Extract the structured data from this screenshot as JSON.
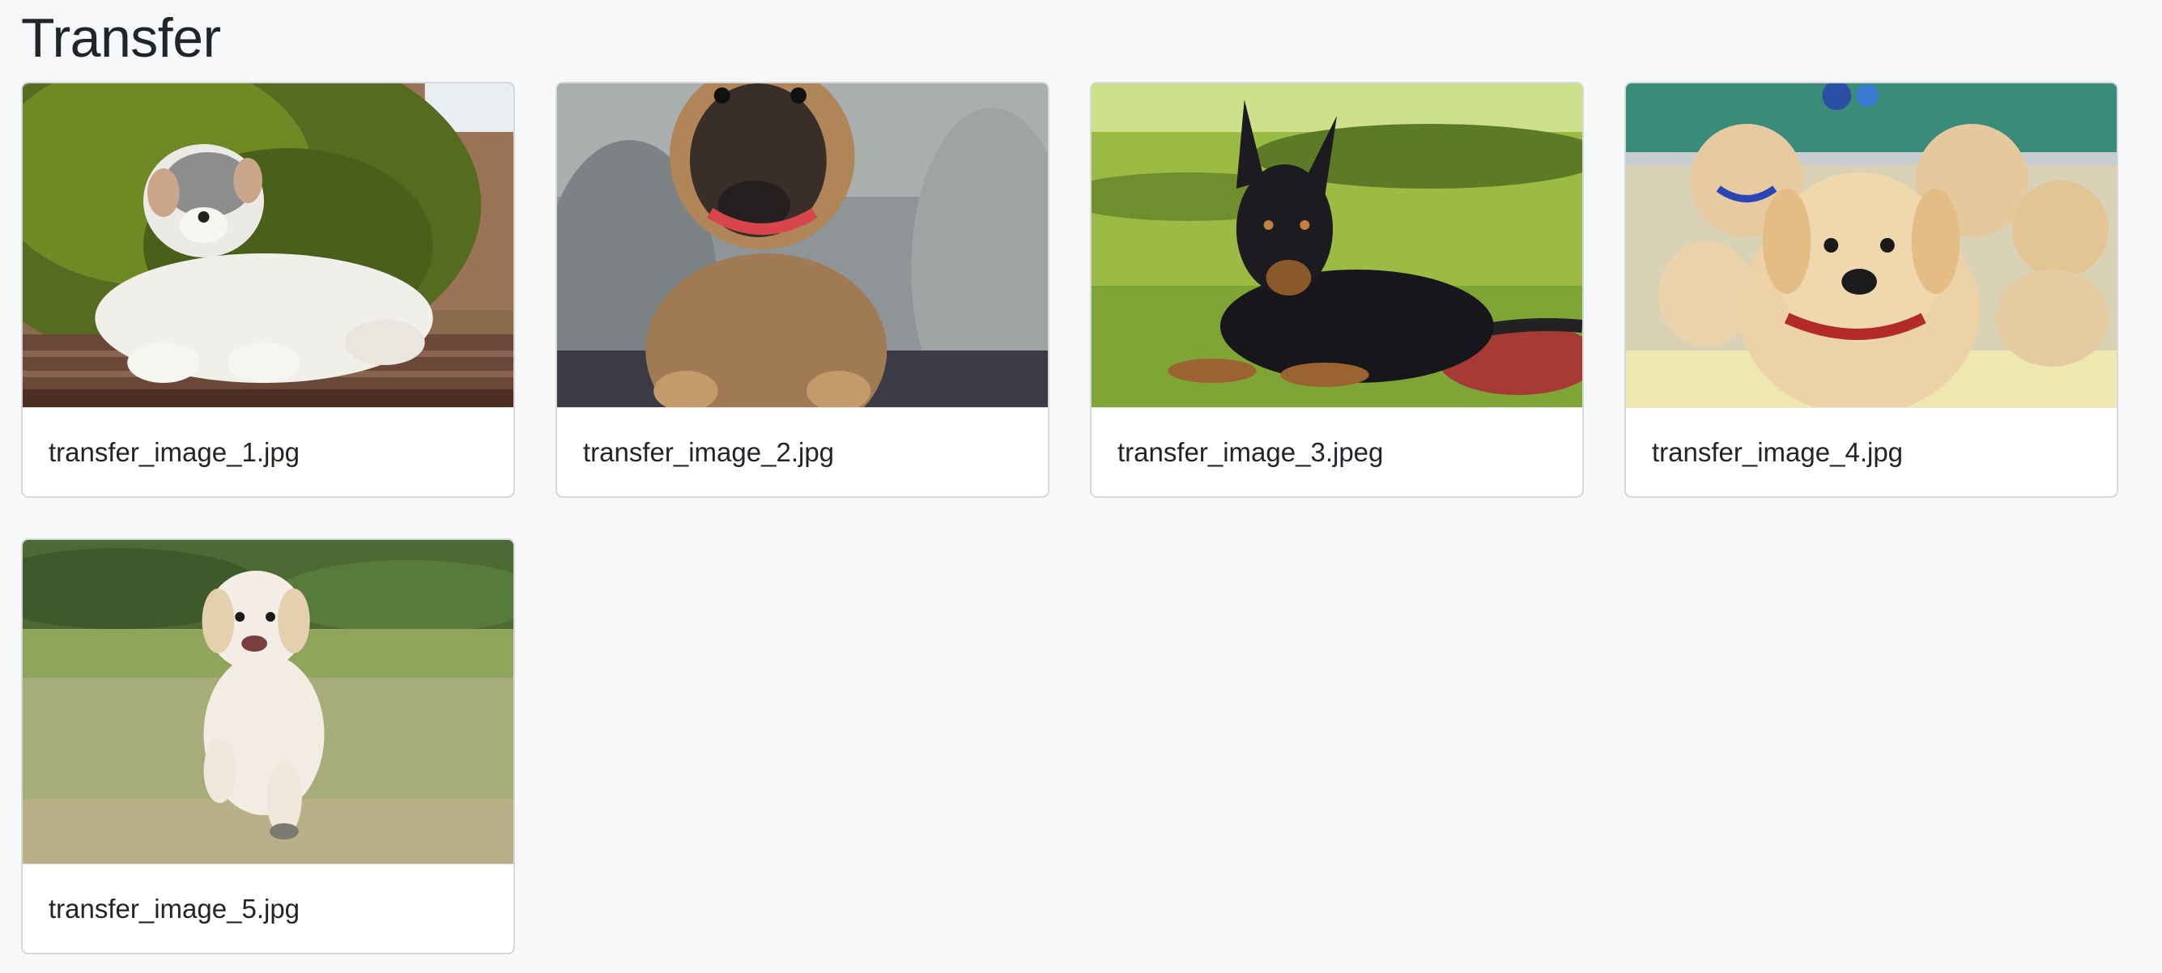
{
  "page": {
    "title": "Transfer"
  },
  "cards": [
    {
      "filename": "transfer_image_1.jpg"
    },
    {
      "filename": "transfer_image_2.jpg"
    },
    {
      "filename": "transfer_image_3.jpeg"
    },
    {
      "filename": "transfer_image_4.jpg"
    },
    {
      "filename": "transfer_image_5.jpg"
    }
  ],
  "colors": {
    "background": "#f7f8fa",
    "card_border": "#d6d8db",
    "text": "#212529"
  }
}
